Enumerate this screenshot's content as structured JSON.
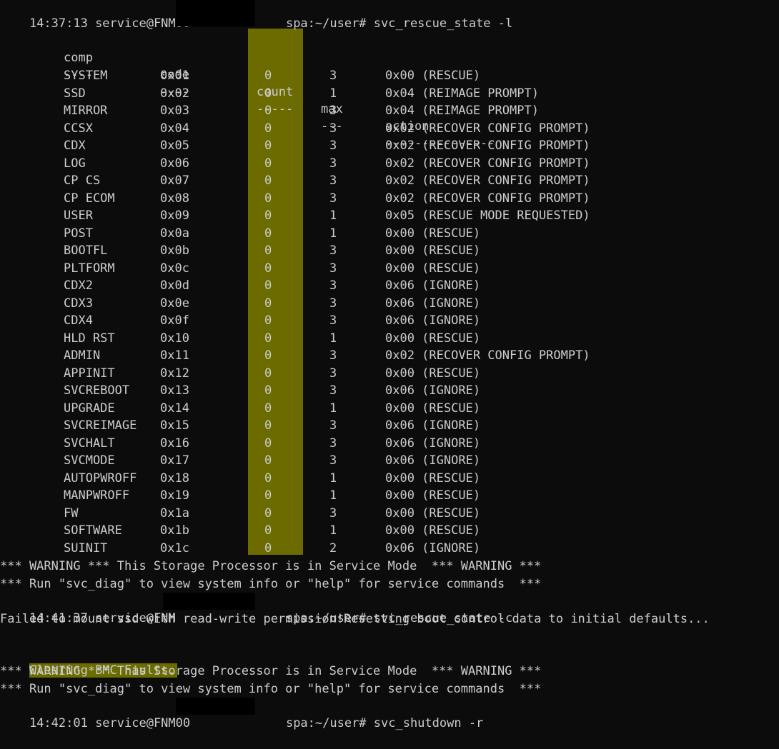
{
  "colors": {
    "background": "#0c0c0c",
    "text": "#cccccc",
    "highlight": "#6b6b00"
  },
  "lines": {
    "prompt1": "14:37:13 service@FNM00",
    "prompt1_rest": "spa:~/user# svc_rescue_state -l",
    "warn1": "*** WARNING *** This Storage Processor is in Service Mode  *** WARNING ***",
    "run1": "*** Run \"svc_diag\" to view system info or \"help\" for service commands  ***",
    "prompt2": "14:41:37 service@FNM",
    "prompt2_rest": "spa:~/user# svc_rescue_state -c",
    "failed": "Failed to mount ssd with read-write permission!Resetting boot control data to initial defaults...",
    "clearing": "Clearing BMC Faults.",
    "warn2": "*** WARNING *** This Storage Processor is in Service Mode  *** WARNING ***",
    "run2": "*** Run \"svc_diag\" to view system info or \"help\" for service commands  ***",
    "prompt3": "14:42:01 service@FNM00",
    "prompt3_rest": "spa:~/user# svc_shutdown -r"
  },
  "table": {
    "headers": {
      "comp": "comp",
      "code": "code",
      "count": "count",
      "max": "max",
      "action": "action"
    },
    "separators": {
      "comp": "----",
      "code": "----",
      "count": "-----",
      "max": "---",
      "action": "---------------"
    },
    "rows": [
      {
        "comp": "SYSTEM",
        "code": "0x01",
        "count": "0",
        "max": "3",
        "action": "0x00 (RESCUE)"
      },
      {
        "comp": "SSD",
        "code": "0x02",
        "count": "0",
        "max": "1",
        "action": "0x04 (REIMAGE PROMPT)"
      },
      {
        "comp": "MIRROR",
        "code": "0x03",
        "count": "0",
        "max": "3",
        "action": "0x04 (REIMAGE PROMPT)"
      },
      {
        "comp": "CCSX",
        "code": "0x04",
        "count": "0",
        "max": "3",
        "action": "0x02 (RECOVER CONFIG PROMPT)"
      },
      {
        "comp": "CDX",
        "code": "0x05",
        "count": "0",
        "max": "3",
        "action": "0x02 (RECOVER CONFIG PROMPT)"
      },
      {
        "comp": "LOG",
        "code": "0x06",
        "count": "0",
        "max": "3",
        "action": "0x02 (RECOVER CONFIG PROMPT)"
      },
      {
        "comp": "CP CS",
        "code": "0x07",
        "count": "0",
        "max": "3",
        "action": "0x02 (RECOVER CONFIG PROMPT)"
      },
      {
        "comp": "CP ECOM",
        "code": "0x08",
        "count": "0",
        "max": "3",
        "action": "0x02 (RECOVER CONFIG PROMPT)"
      },
      {
        "comp": "USER",
        "code": "0x09",
        "count": "0",
        "max": "1",
        "action": "0x05 (RESCUE MODE REQUESTED)"
      },
      {
        "comp": "POST",
        "code": "0x0a",
        "count": "0",
        "max": "1",
        "action": "0x00 (RESCUE)"
      },
      {
        "comp": "BOOTFL",
        "code": "0x0b",
        "count": "0",
        "max": "3",
        "action": "0x00 (RESCUE)"
      },
      {
        "comp": "PLTFORM",
        "code": "0x0c",
        "count": "0",
        "max": "3",
        "action": "0x00 (RESCUE)"
      },
      {
        "comp": "CDX2",
        "code": "0x0d",
        "count": "0",
        "max": "3",
        "action": "0x06 (IGNORE)"
      },
      {
        "comp": "CDX3",
        "code": "0x0e",
        "count": "0",
        "max": "3",
        "action": "0x06 (IGNORE)"
      },
      {
        "comp": "CDX4",
        "code": "0x0f",
        "count": "0",
        "max": "3",
        "action": "0x06 (IGNORE)"
      },
      {
        "comp": "HLD RST",
        "code": "0x10",
        "count": "0",
        "max": "1",
        "action": "0x00 (RESCUE)"
      },
      {
        "comp": "ADMIN",
        "code": "0x11",
        "count": "0",
        "max": "3",
        "action": "0x02 (RECOVER CONFIG PROMPT)"
      },
      {
        "comp": "APPINIT",
        "code": "0x12",
        "count": "0",
        "max": "3",
        "action": "0x00 (RESCUE)"
      },
      {
        "comp": "SVCREBOOT",
        "code": "0x13",
        "count": "0",
        "max": "3",
        "action": "0x06 (IGNORE)"
      },
      {
        "comp": "UPGRADE",
        "code": "0x14",
        "count": "0",
        "max": "1",
        "action": "0x00 (RESCUE)"
      },
      {
        "comp": "SVCREIMAGE",
        "code": "0x15",
        "count": "0",
        "max": "3",
        "action": "0x06 (IGNORE)"
      },
      {
        "comp": "SVCHALT",
        "code": "0x16",
        "count": "0",
        "max": "3",
        "action": "0x06 (IGNORE)"
      },
      {
        "comp": "SVCMODE",
        "code": "0x17",
        "count": "0",
        "max": "3",
        "action": "0x06 (IGNORE)"
      },
      {
        "comp": "AUTOPWROFF",
        "code": "0x18",
        "count": "0",
        "max": "1",
        "action": "0x00 (RESCUE)"
      },
      {
        "comp": "MANPWROFF",
        "code": "0x19",
        "count": "0",
        "max": "1",
        "action": "0x00 (RESCUE)"
      },
      {
        "comp": "FW",
        "code": "0x1a",
        "count": "0",
        "max": "3",
        "action": "0x00 (RESCUE)"
      },
      {
        "comp": "SOFTWARE",
        "code": "0x1b",
        "count": "0",
        "max": "1",
        "action": "0x00 (RESCUE)"
      },
      {
        "comp": "SUINIT",
        "code": "0x1c",
        "count": "0",
        "max": "2",
        "action": "0x06 (IGNORE)"
      }
    ]
  }
}
